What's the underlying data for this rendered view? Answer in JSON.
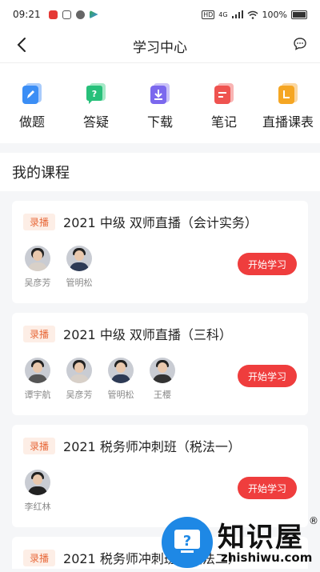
{
  "status": {
    "time": "09:21",
    "battery": "100%",
    "network": "4G"
  },
  "nav": {
    "title": "学习中心"
  },
  "quick": [
    {
      "label": "做题",
      "icon": "pencil-icon",
      "color": "#3b8ef5"
    },
    {
      "label": "答疑",
      "icon": "question-icon",
      "color": "#27c07a"
    },
    {
      "label": "下载",
      "icon": "download-icon",
      "color": "#7b68ee"
    },
    {
      "label": "笔记",
      "icon": "note-icon",
      "color": "#ef5350"
    },
    {
      "label": "直播课表",
      "icon": "schedule-icon",
      "color": "#f5a623"
    }
  ],
  "section": {
    "title": "我的课程"
  },
  "courses": [
    {
      "tag": "录播",
      "title": "2021 中级 双师直播（会计实务）",
      "button": "开始学习",
      "teachers": [
        {
          "name": "吴彦芳"
        },
        {
          "name": "管明松"
        }
      ]
    },
    {
      "tag": "录播",
      "title": "2021 中级 双师直播（三科）",
      "button": "开始学习",
      "teachers": [
        {
          "name": "谭宇航"
        },
        {
          "name": "吴彦芳"
        },
        {
          "name": "管明松"
        },
        {
          "name": "王樱"
        }
      ]
    },
    {
      "tag": "录播",
      "title": "2021 税务师冲刺班（税法一）",
      "button": "开始学习",
      "teachers": [
        {
          "name": "李红林"
        }
      ]
    },
    {
      "tag": "录播",
      "title": "2021 税务师冲刺班（税法二）"
    }
  ],
  "watermark": {
    "text": "知识屋",
    "url": "zhishiwu.com"
  }
}
